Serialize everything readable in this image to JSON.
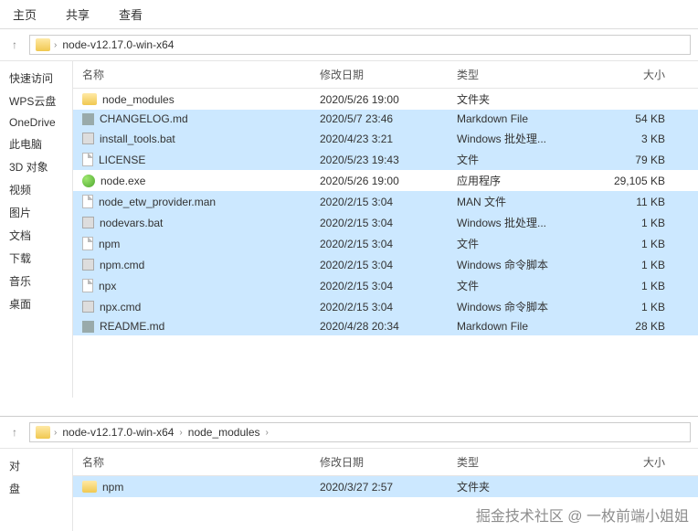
{
  "tabs": {
    "home": "主页",
    "share": "共享",
    "view": "查看"
  },
  "breadcrumb1": {
    "path": "node-v12.17.0-win-x64"
  },
  "breadcrumb2": {
    "path1": "node-v12.17.0-win-x64",
    "path2": "node_modules"
  },
  "sidebar": {
    "items": [
      "快速访问",
      "WPS云盘",
      "OneDrive",
      "此电脑",
      "3D 对象",
      "视频",
      "图片",
      "文档",
      "下载",
      "音乐",
      "桌面"
    ]
  },
  "sidebar2": {
    "items": [
      "对",
      "盘"
    ]
  },
  "columns": {
    "name": "名称",
    "date": "修改日期",
    "type": "类型",
    "size": "大小"
  },
  "files": [
    {
      "name": "node_modules",
      "date": "2020/5/26 19:00",
      "type": "文件夹",
      "size": "",
      "icon": "folder",
      "sel": false
    },
    {
      "name": "CHANGELOG.md",
      "date": "2020/5/7 23:46",
      "type": "Markdown File",
      "size": "54 KB",
      "icon": "md",
      "sel": true
    },
    {
      "name": "install_tools.bat",
      "date": "2020/4/23 3:21",
      "type": "Windows 批处理...",
      "size": "3 KB",
      "icon": "bat",
      "sel": true
    },
    {
      "name": "LICENSE",
      "date": "2020/5/23 19:43",
      "type": "文件",
      "size": "79 KB",
      "icon": "file",
      "sel": true
    },
    {
      "name": "node.exe",
      "date": "2020/5/26 19:00",
      "type": "应用程序",
      "size": "29,105 KB",
      "icon": "exe",
      "sel": false
    },
    {
      "name": "node_etw_provider.man",
      "date": "2020/2/15 3:04",
      "type": "MAN 文件",
      "size": "11 KB",
      "icon": "file",
      "sel": true
    },
    {
      "name": "nodevars.bat",
      "date": "2020/2/15 3:04",
      "type": "Windows 批处理...",
      "size": "1 KB",
      "icon": "bat",
      "sel": true
    },
    {
      "name": "npm",
      "date": "2020/2/15 3:04",
      "type": "文件",
      "size": "1 KB",
      "icon": "file",
      "sel": true
    },
    {
      "name": "npm.cmd",
      "date": "2020/2/15 3:04",
      "type": "Windows 命令脚本",
      "size": "1 KB",
      "icon": "bat",
      "sel": true
    },
    {
      "name": "npx",
      "date": "2020/2/15 3:04",
      "type": "文件",
      "size": "1 KB",
      "icon": "file",
      "sel": true
    },
    {
      "name": "npx.cmd",
      "date": "2020/2/15 3:04",
      "type": "Windows 命令脚本",
      "size": "1 KB",
      "icon": "bat",
      "sel": true
    },
    {
      "name": "README.md",
      "date": "2020/4/28 20:34",
      "type": "Markdown File",
      "size": "28 KB",
      "icon": "md",
      "sel": true
    }
  ],
  "files2": [
    {
      "name": "npm",
      "date": "2020/3/27 2:57",
      "type": "文件夹",
      "size": "",
      "icon": "folder",
      "sel": true
    }
  ],
  "watermark": "掘金技术社区 @ 一枚前端小姐姐"
}
